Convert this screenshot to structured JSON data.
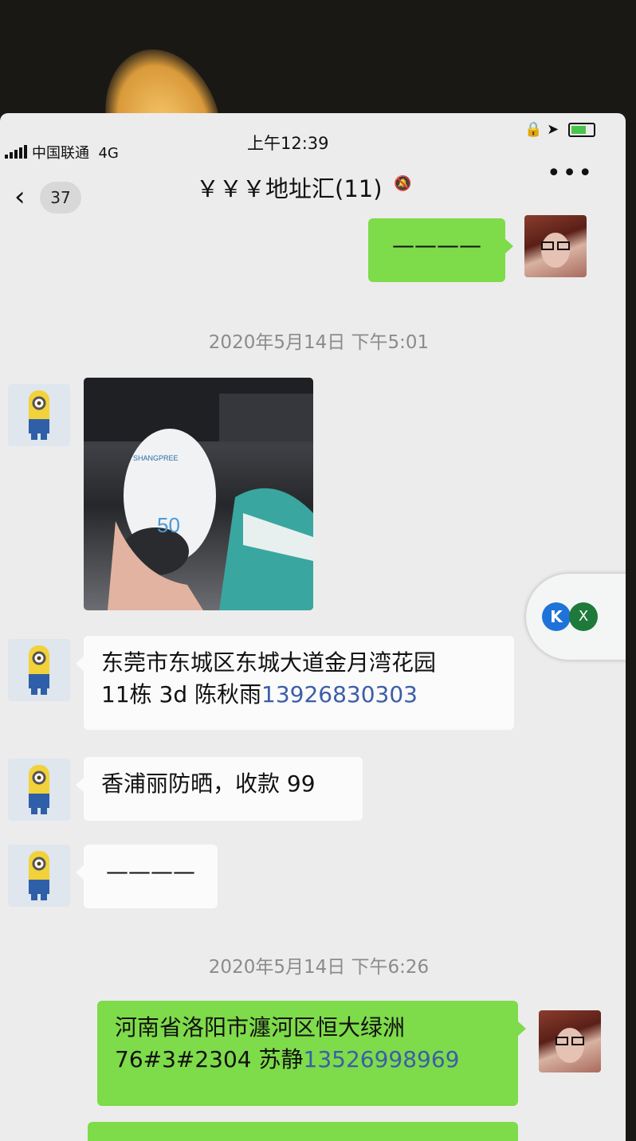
{
  "status_bar": {
    "carrier": "中国联通",
    "network": "4G",
    "time": "上午12:39"
  },
  "nav": {
    "back_icon": "chevron-left-icon",
    "unread_count": "37",
    "title": "￥￥￥地址汇(11)",
    "mute_icon": "bell-muted-icon",
    "more_icon": "more-icon"
  },
  "messages": [
    {
      "type": "text",
      "direction": "out",
      "text": "————"
    },
    {
      "type": "timestamp",
      "text": "2020年5月14日 下午5:01"
    },
    {
      "type": "image",
      "direction": "in",
      "label": "SHANGPREE",
      "spf": "50"
    },
    {
      "type": "text",
      "direction": "in",
      "line1": "东莞市东城区东城大道金月湾花园",
      "line2": "11栋 3d 陈秋雨",
      "phone": "13926830303"
    },
    {
      "type": "text",
      "direction": "in",
      "text": "香浦丽防晒，收款 99"
    },
    {
      "type": "text",
      "direction": "in",
      "text": "————"
    },
    {
      "type": "timestamp",
      "text": "2020年5月14日 下午6:26"
    },
    {
      "type": "text",
      "direction": "out",
      "line1": "河南省洛阳市瀍河区恒大绿洲",
      "line2": "76#3#2304  苏静",
      "phone": "13526998969"
    }
  ],
  "floating_widget": {
    "logo_text": "K",
    "close_text": "X"
  },
  "colors": {
    "out_bubble": "#7edb4a",
    "in_bubble": "#fbfbfb",
    "phone_link": "#3b5ea8",
    "screen_bg": "#ececec"
  }
}
